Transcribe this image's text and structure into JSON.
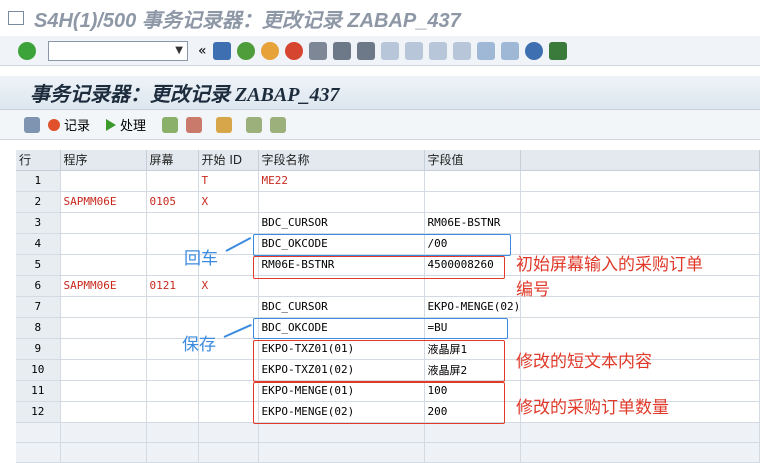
{
  "window": {
    "title": "S4H(1)/500 事务记录器：更改记录 ZABAP_437"
  },
  "header": {
    "title": "事务记录器：更改记录 ZABAP_437"
  },
  "app_toolbar": {
    "record": "记录",
    "process": "处理"
  },
  "table": {
    "columns": [
      "行",
      "程序",
      "屏幕",
      "开始 ID",
      "字段名称",
      "字段值"
    ],
    "rows": [
      [
        "1",
        "",
        "",
        "T",
        "ME22",
        ""
      ],
      [
        "2",
        "SAPMM06E",
        "0105",
        "X",
        "",
        ""
      ],
      [
        "3",
        "",
        "",
        "",
        "BDC_CURSOR",
        "RM06E-BSTNR"
      ],
      [
        "4",
        "",
        "",
        "",
        "BDC_OKCODE",
        "/00"
      ],
      [
        "5",
        "",
        "",
        "",
        "RM06E-BSTNR",
        "4500008260"
      ],
      [
        "6",
        "SAPMM06E",
        "0121",
        "X",
        "",
        ""
      ],
      [
        "7",
        "",
        "",
        "",
        "BDC_CURSOR",
        "EKPO-MENGE(02)"
      ],
      [
        "8",
        "",
        "",
        "",
        "BDC_OKCODE",
        "=BU"
      ],
      [
        "9",
        "",
        "",
        "",
        "EKPO-TXZ01(01)",
        "液晶屏1"
      ],
      [
        "10",
        "",
        "",
        "",
        "EKPO-TXZ01(02)",
        "液晶屏2"
      ],
      [
        "11",
        "",
        "",
        "",
        "EKPO-MENGE(01)",
        "100"
      ],
      [
        "12",
        "",
        "",
        "",
        "EKPO-MENGE(02)",
        "200"
      ]
    ]
  },
  "annotations": {
    "enter": "回车",
    "save": "保存",
    "initial": "初始屏幕输入的采购订单",
    "initial2": "编号",
    "short_text": "修改的短文本内容",
    "quantity": "修改的采购订单数量"
  },
  "colors": {
    "red": "#e03a2a",
    "blue": "#3b8be0"
  }
}
